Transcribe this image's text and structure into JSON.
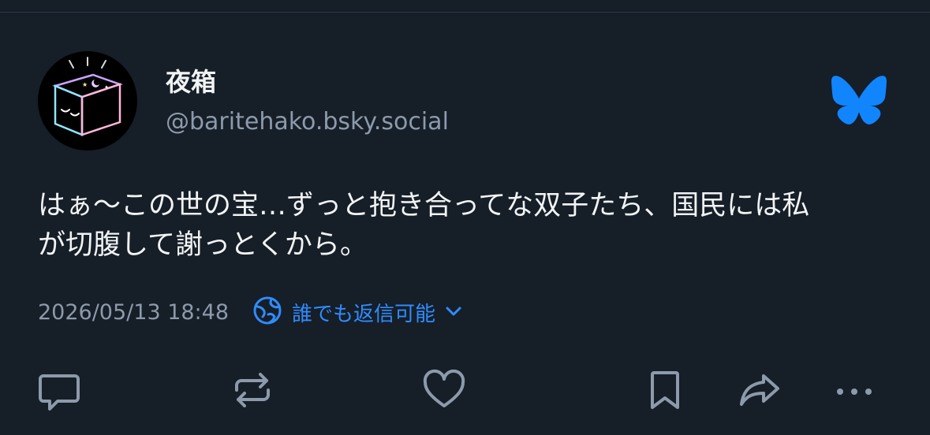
{
  "author": {
    "display_name": "夜箱",
    "handle": "@baritehako.bsky.social"
  },
  "brand": {
    "icon": "bluesky-butterfly-icon",
    "color": "#1185fe"
  },
  "post": {
    "text_lines": [
      "はぁ〜この世の宝…ずっと抱き合ってな双子たち、国民には私",
      "が切腹して謝っとくから。"
    ],
    "timestamp": "2026/05/13 18:48",
    "reply_setting": "誰でも返信可能"
  },
  "actions": [
    {
      "name": "reply",
      "icon": "speech-bubble-icon"
    },
    {
      "name": "repost",
      "icon": "repost-icon"
    },
    {
      "name": "like",
      "icon": "heart-icon"
    },
    {
      "name": "bookmark",
      "icon": "bookmark-icon"
    },
    {
      "name": "share",
      "icon": "share-arrow-icon"
    },
    {
      "name": "more",
      "icon": "ellipsis-icon"
    }
  ],
  "colors": {
    "background": "#161e27",
    "text": "#f1f3f5",
    "muted": "#8c9aab",
    "accent": "#2f8cff"
  }
}
